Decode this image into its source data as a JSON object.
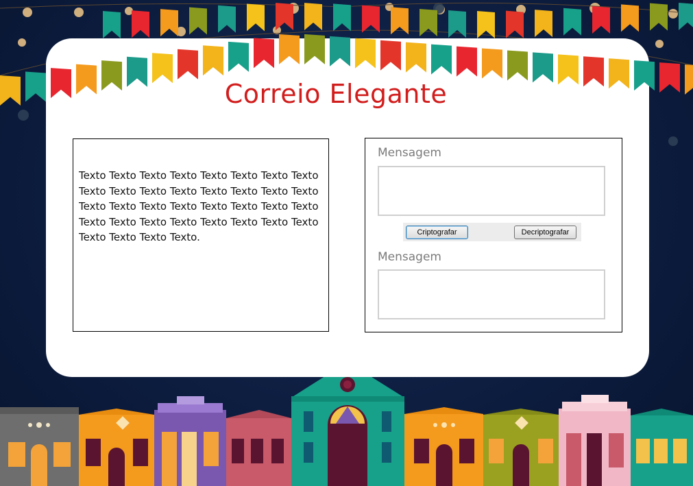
{
  "title": "Correio Elegante",
  "text_panel": {
    "body": "Texto Texto Texto Texto Texto Texto Texto Texto Texto Texto Texto Texto Texto Texto Texto Texto Texto Texto Texto Texto Texto Texto Texto Texto Texto Texto Texto Texto Texto Texto Texto Texto Texto Texto Texto Texto."
  },
  "form": {
    "input_label": "Mensagem",
    "output_label": "Mensagem",
    "encrypt_label": "Criptografar",
    "decrypt_label": "Decriptografar"
  },
  "colors": {
    "background": "#0b1a3a",
    "card": "#ffffff",
    "title": "#d21d1d"
  }
}
